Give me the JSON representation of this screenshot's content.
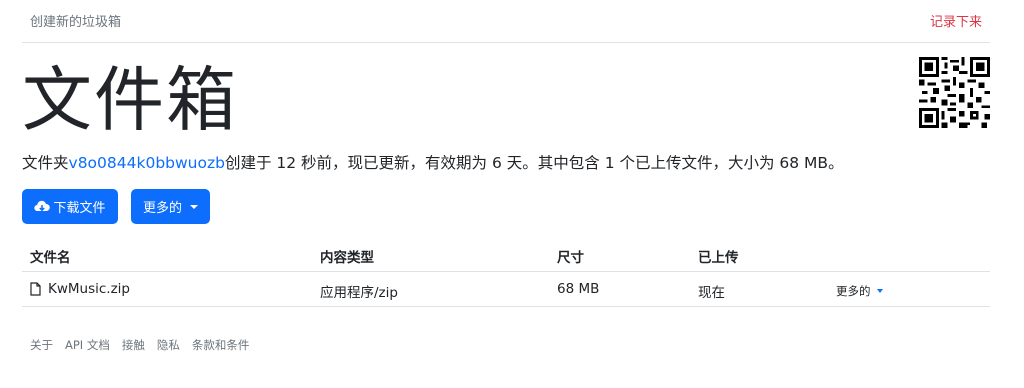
{
  "topbar": {
    "create_label": "创建新的垃圾箱",
    "remember_label": "记录下来"
  },
  "page_title": "文件箱",
  "info": {
    "prefix": "文件夹",
    "folder_id": "v8o0844k0bbwuozb",
    "suffix": "创建于 12 秒前，现已更新，有效期为 6 天。其中包含 1 个已上传文件，大小为 68 MB。"
  },
  "actions": {
    "download_label": "下载文件",
    "more_label": "更多的"
  },
  "table": {
    "headers": [
      "文件名",
      "内容类型",
      "尺寸",
      "已上传"
    ],
    "rows": [
      {
        "name": "KwMusic.zip",
        "type": "应用程序/zip",
        "size": "68 MB",
        "uploaded": "现在",
        "more": "更多的"
      }
    ]
  },
  "footer": {
    "links": [
      "关于",
      "API 文档",
      "接触",
      "隐私",
      "条款和条件"
    ]
  },
  "colors": {
    "primary": "#0d6efd",
    "danger": "#dc3545",
    "muted": "#6c757d"
  },
  "icons": {
    "download": "cloud-download-icon",
    "file": "file-icon",
    "qr": "qr-code-icon"
  }
}
